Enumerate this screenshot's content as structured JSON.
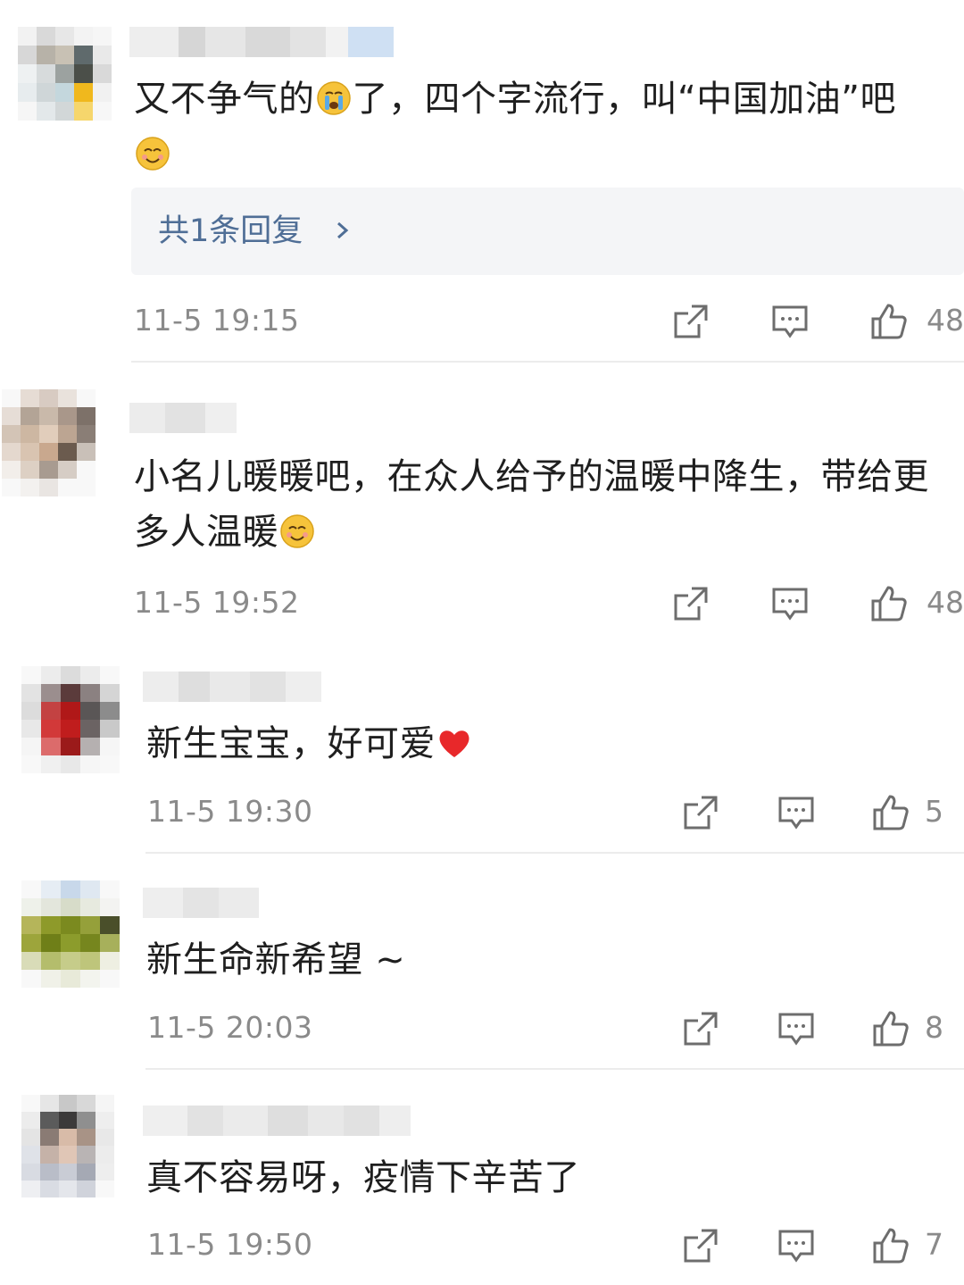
{
  "comments": [
    {
      "text": "又不争气的",
      "text_mid": "了，四个字流行，叫“中国加油”吧",
      "emoji_mid": "crying-face",
      "emoji_end": "smiling-face",
      "reply_link": "共1条回复",
      "time": "11-5 19:15",
      "likes": "48"
    },
    {
      "text": "小名儿暖暖吧，在众人给予的温暖中降生，带给更多人温暖",
      "emoji_end": "smiling-face",
      "time": "11-5 19:52",
      "likes": "48"
    },
    {
      "text": "新生宝宝，好可爱",
      "emoji_end": "red-heart",
      "time": "11-5 19:30",
      "likes": "5"
    },
    {
      "text": "新生命新希望 ~",
      "time": "11-5 20:03",
      "likes": "8"
    },
    {
      "text": "真不容易呀，疫情下辛苦了",
      "time": "11-5 19:50",
      "likes": "7"
    }
  ],
  "colors": {
    "reply_link": "#4f6e96",
    "reply_bg": "#f4f5f7",
    "meta_text": "#8a8a8a",
    "divider": "#ececec"
  },
  "icons": [
    "share-icon",
    "comment-icon",
    "like-icon",
    "chevron-right-icon"
  ]
}
